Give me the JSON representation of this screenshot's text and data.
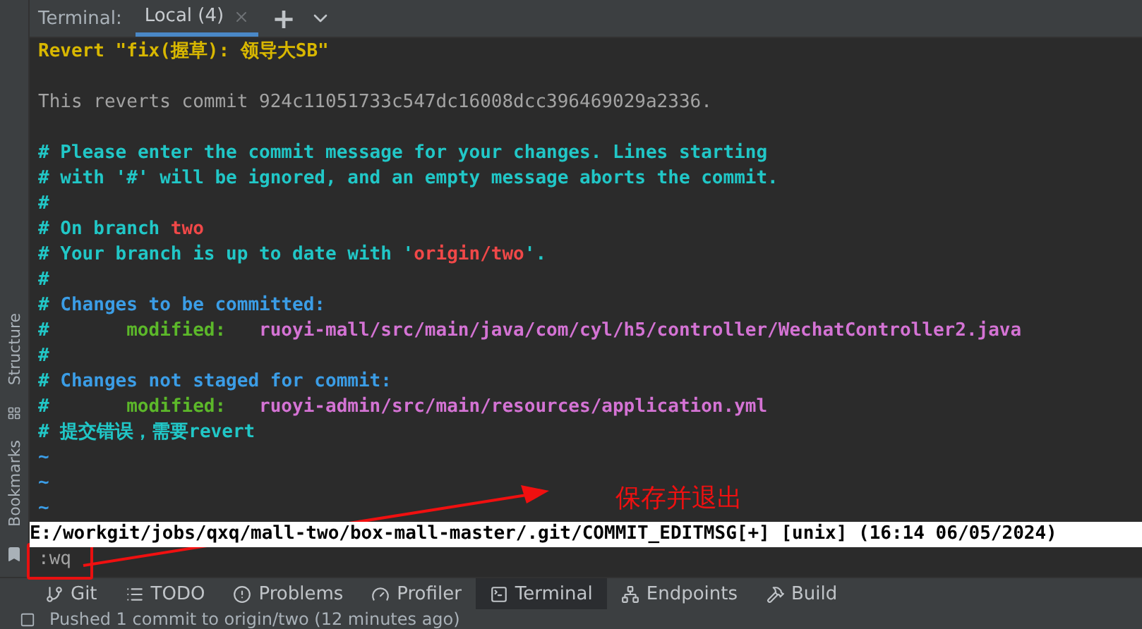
{
  "terminal_tabs": {
    "label": "Terminal:",
    "tabs": [
      {
        "title": "Local (4)",
        "selected": true
      }
    ],
    "add_symbol": "+"
  },
  "side_panels": [
    {
      "label": "Structure"
    },
    {
      "label": "Bookmarks"
    }
  ],
  "lines": [
    {
      "segments": [
        {
          "kind": "title",
          "text": "Revert \"fix(握草): 领导大SB\""
        }
      ]
    },
    {
      "kind": "blank"
    },
    {
      "segments": [
        {
          "kind": "text",
          "text": "This reverts commit 924c11051733c547dc16008dcc396469029a2336."
        }
      ]
    },
    {
      "kind": "blank"
    },
    {
      "segments": [
        {
          "kind": "comment",
          "text": "# Please enter the commit message for your changes. Lines starting"
        }
      ]
    },
    {
      "segments": [
        {
          "kind": "comment",
          "text": "# with '#' will be ignored, and an empty message aborts the commit."
        }
      ]
    },
    {
      "segments": [
        {
          "kind": "comment",
          "text": "#"
        }
      ]
    },
    {
      "segments": [
        {
          "kind": "comment",
          "text": "# On branch "
        },
        {
          "kind": "branch",
          "text": "two"
        }
      ]
    },
    {
      "segments": [
        {
          "kind": "comment",
          "text": "# Your branch is up to date with '"
        },
        {
          "kind": "branch",
          "text": "origin/two"
        },
        {
          "kind": "comment",
          "text": "'."
        }
      ]
    },
    {
      "segments": [
        {
          "kind": "comment",
          "text": "#"
        }
      ]
    },
    {
      "segments": [
        {
          "kind": "comment",
          "text": "# "
        },
        {
          "kind": "heading",
          "text": "Changes to be committed:"
        }
      ]
    },
    {
      "segments": [
        {
          "kind": "comment",
          "text": "#"
        },
        {
          "kind": "label",
          "text": "modified:"
        },
        {
          "kind": "path",
          "text": "ruoyi-mall/src/main/java/com/cyl/h5/controller/WechatController2.java"
        }
      ]
    },
    {
      "segments": [
        {
          "kind": "comment",
          "text": "#"
        }
      ]
    },
    {
      "segments": [
        {
          "kind": "comment",
          "text": "# "
        },
        {
          "kind": "heading",
          "text": "Changes not staged for commit:"
        }
      ]
    },
    {
      "segments": [
        {
          "kind": "comment",
          "text": "#"
        },
        {
          "kind": "label",
          "text": "modified:"
        },
        {
          "kind": "path",
          "text": "ruoyi-admin/src/main/resources/application.yml"
        }
      ]
    },
    {
      "segments": [
        {
          "kind": "comment",
          "text": "# 提交错误，需要revert"
        }
      ]
    },
    {
      "segments": [
        {
          "kind": "tilde",
          "text": "~"
        }
      ]
    },
    {
      "segments": [
        {
          "kind": "tilde",
          "text": "~"
        }
      ]
    },
    {
      "segments": [
        {
          "kind": "tilde",
          "text": "~"
        }
      ]
    }
  ],
  "vim_status": "E:/workgit/jobs/qxq/mall-two/box-mall-master/.git/COMMIT_EDITMSG[+] [unix] (16:14 06/05/2024)",
  "command": ":wq",
  "annotation": "保存并退出",
  "tool_windows": [
    {
      "label": "Git",
      "selected": false
    },
    {
      "label": "TODO",
      "selected": false
    },
    {
      "label": "Problems",
      "selected": false
    },
    {
      "label": "Profiler",
      "selected": false
    },
    {
      "label": "Terminal",
      "selected": true
    },
    {
      "label": "Endpoints",
      "selected": false
    },
    {
      "label": "Build",
      "selected": false
    }
  ],
  "status_bar": "Pushed 1 commit to origin/two (12 minutes ago)"
}
